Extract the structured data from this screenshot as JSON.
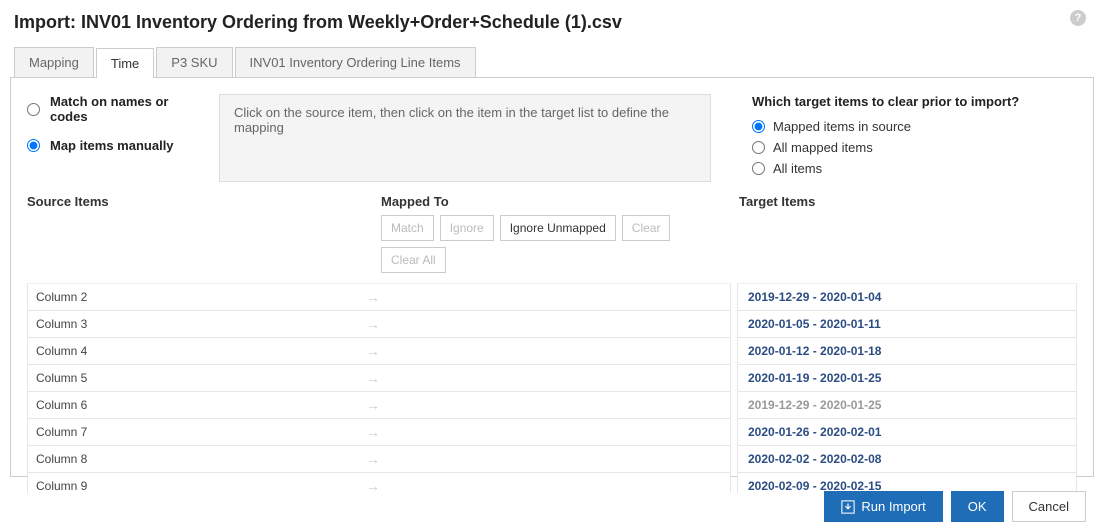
{
  "title": "Import: INV01 Inventory Ordering from Weekly+Order+Schedule (1).csv",
  "tabs": [
    {
      "label": "Mapping",
      "active": false
    },
    {
      "label": "Time",
      "active": true
    },
    {
      "label": "P3 SKU",
      "active": false
    },
    {
      "label": "INV01 Inventory Ordering Line Items",
      "active": false
    }
  ],
  "mapping_mode": {
    "match_label": "Match on names or codes",
    "manual_label": "Map items manually",
    "selected": "manual"
  },
  "hint": "Click on the source item, then click on the item in the target list to define the mapping",
  "clear_options": {
    "question": "Which target items to clear prior to import?",
    "options": [
      {
        "label": "Mapped items in source",
        "selected": true
      },
      {
        "label": "All mapped items",
        "selected": false
      },
      {
        "label": "All items",
        "selected": false
      }
    ]
  },
  "headers": {
    "source": "Source Items",
    "mapped": "Mapped To",
    "target": "Target Items"
  },
  "mapped_buttons": {
    "match": "Match",
    "ignore": "Ignore",
    "ignore_unmapped": "Ignore Unmapped",
    "clear": "Clear",
    "clear_all": "Clear All"
  },
  "source_items": [
    "Column 2",
    "Column 3",
    "Column 4",
    "Column 5",
    "Column 6",
    "Column 7",
    "Column 8",
    "Column 9"
  ],
  "target_items": [
    {
      "label": "2019-12-29 - 2020-01-04",
      "muted": false
    },
    {
      "label": "2020-01-05 - 2020-01-11",
      "muted": false
    },
    {
      "label": "2020-01-12 - 2020-01-18",
      "muted": false
    },
    {
      "label": "2020-01-19 - 2020-01-25",
      "muted": false
    },
    {
      "label": "2019-12-29 - 2020-01-25",
      "muted": true
    },
    {
      "label": "2020-01-26 - 2020-02-01",
      "muted": false
    },
    {
      "label": "2020-02-02 - 2020-02-08",
      "muted": false
    },
    {
      "label": "2020-02-09 - 2020-02-15",
      "muted": false
    }
  ],
  "footer": {
    "run_import": "Run Import",
    "ok": "OK",
    "cancel": "Cancel"
  }
}
